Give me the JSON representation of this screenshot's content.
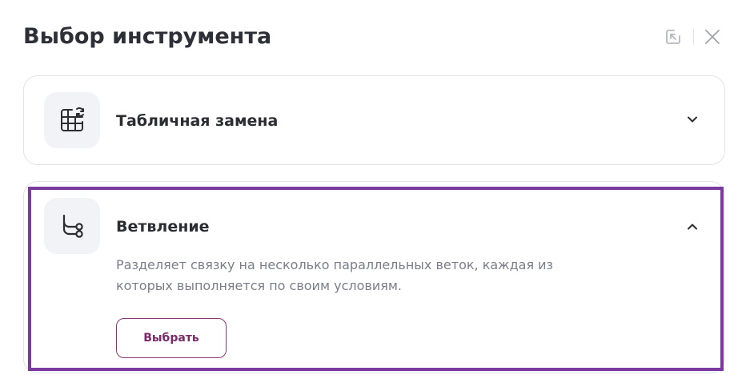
{
  "dialog": {
    "title": "Выбор инструмента",
    "actions": [
      {
        "icon": "back-arrow-icon"
      },
      {
        "icon": "close-icon"
      }
    ]
  },
  "tools": [
    {
      "label": "Табличная замена",
      "icon": "table-refresh-icon",
      "expanded": false
    },
    {
      "label": "Ветвление",
      "icon": "branch-icon",
      "expanded": true,
      "description": "Разделяет связку на несколько параллельных веток, каждая из которых выполняется по своим условиям.",
      "select_label": "Выбрать"
    }
  ],
  "colors": {
    "accent": "#7a2a6c",
    "highlight": "#7b3aa0",
    "text": "#2b2d33",
    "muted": "#7a7e89",
    "tile": "#f2f3f6",
    "border": "#e2e3e7"
  }
}
